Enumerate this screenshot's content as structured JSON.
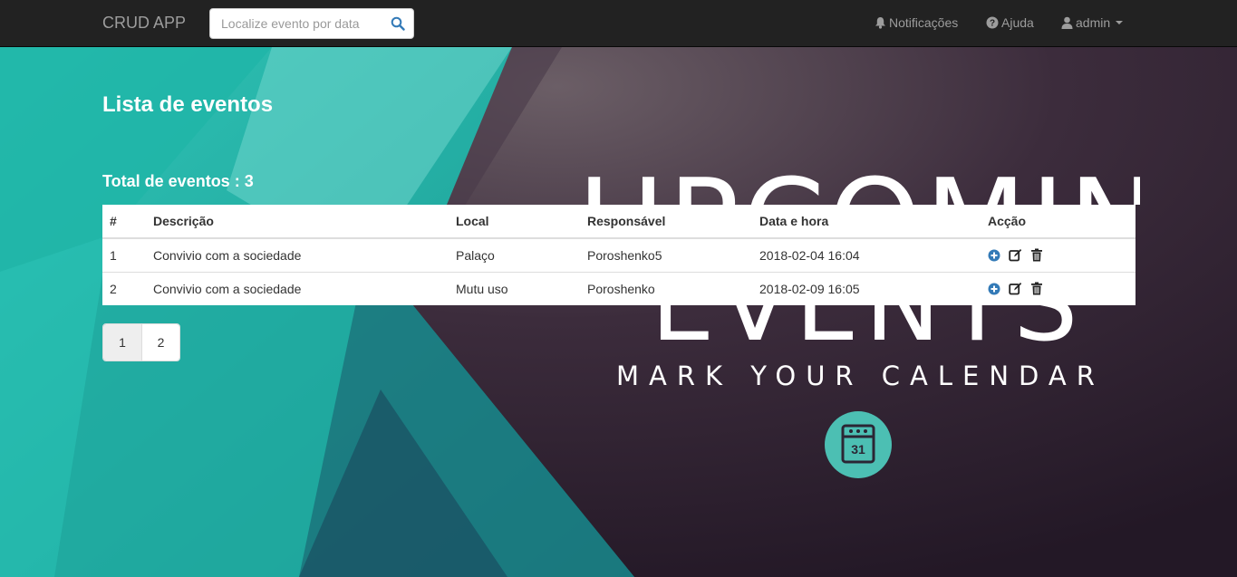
{
  "navbar": {
    "brand": "CRUD APP",
    "search_placeholder": "Localize evento por data",
    "notifications_label": "Notificações",
    "help_label": "Ajuda",
    "user_label": "admin"
  },
  "banner": {
    "line1": "UPCOMING",
    "line2": "EVENTS",
    "line3": "MARK YOUR CALENDAR",
    "calendar_day": "31",
    "colors": {
      "teal": "#2ec4b6",
      "dark": "#2a1d2b",
      "badge": "#4cbfb3"
    }
  },
  "main": {
    "title": "Lista de eventos",
    "total_label": "Total de eventos : 3"
  },
  "table": {
    "headers": [
      "#",
      "Descrição",
      "Local",
      "Responsável",
      "Data e hora",
      "Acção"
    ],
    "rows": [
      {
        "num": "1",
        "description": "Convivio com a sociedade",
        "local": "Palaço",
        "responsible": "Poroshenko5",
        "datetime": "2018-02-04 16:04"
      },
      {
        "num": "2",
        "description": "Convivio com a sociedade",
        "local": "Mutu uso",
        "responsible": "Poroshenko",
        "datetime": "2018-02-09 16:05"
      }
    ],
    "action_icons": [
      "plus-circle-icon",
      "edit-icon",
      "trash-icon"
    ]
  },
  "pagination": {
    "pages": [
      "1",
      "2"
    ],
    "active": "1"
  }
}
